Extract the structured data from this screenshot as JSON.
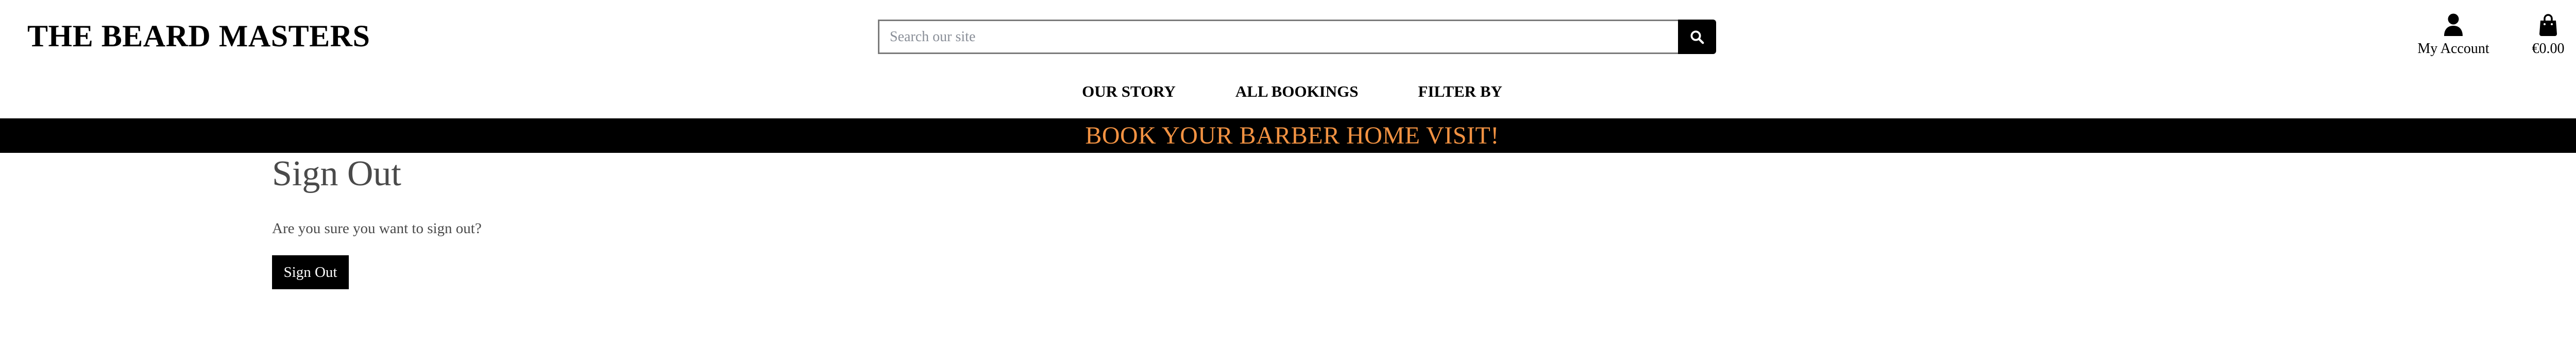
{
  "header": {
    "brand": "THE BEARD MASTERS",
    "search": {
      "placeholder": "Search our site",
      "value": ""
    },
    "search_button_icon": "search-icon",
    "account": {
      "icon": "user-icon",
      "label": "My Account"
    },
    "bag": {
      "icon": "shopping-bag-icon",
      "total": "€0.00"
    }
  },
  "nav": {
    "items": [
      {
        "label": "OUR STORY"
      },
      {
        "label": "ALL BOOKINGS"
      },
      {
        "label": "FILTER BY"
      }
    ]
  },
  "banner": {
    "text": "BOOK YOUR BARBER HOME VISIT!",
    "color": "#f29242",
    "background": "#000000"
  },
  "main": {
    "title": "Sign Out",
    "confirm_text": "Are you sure you want to sign out?",
    "signout_label": "Sign Out"
  }
}
